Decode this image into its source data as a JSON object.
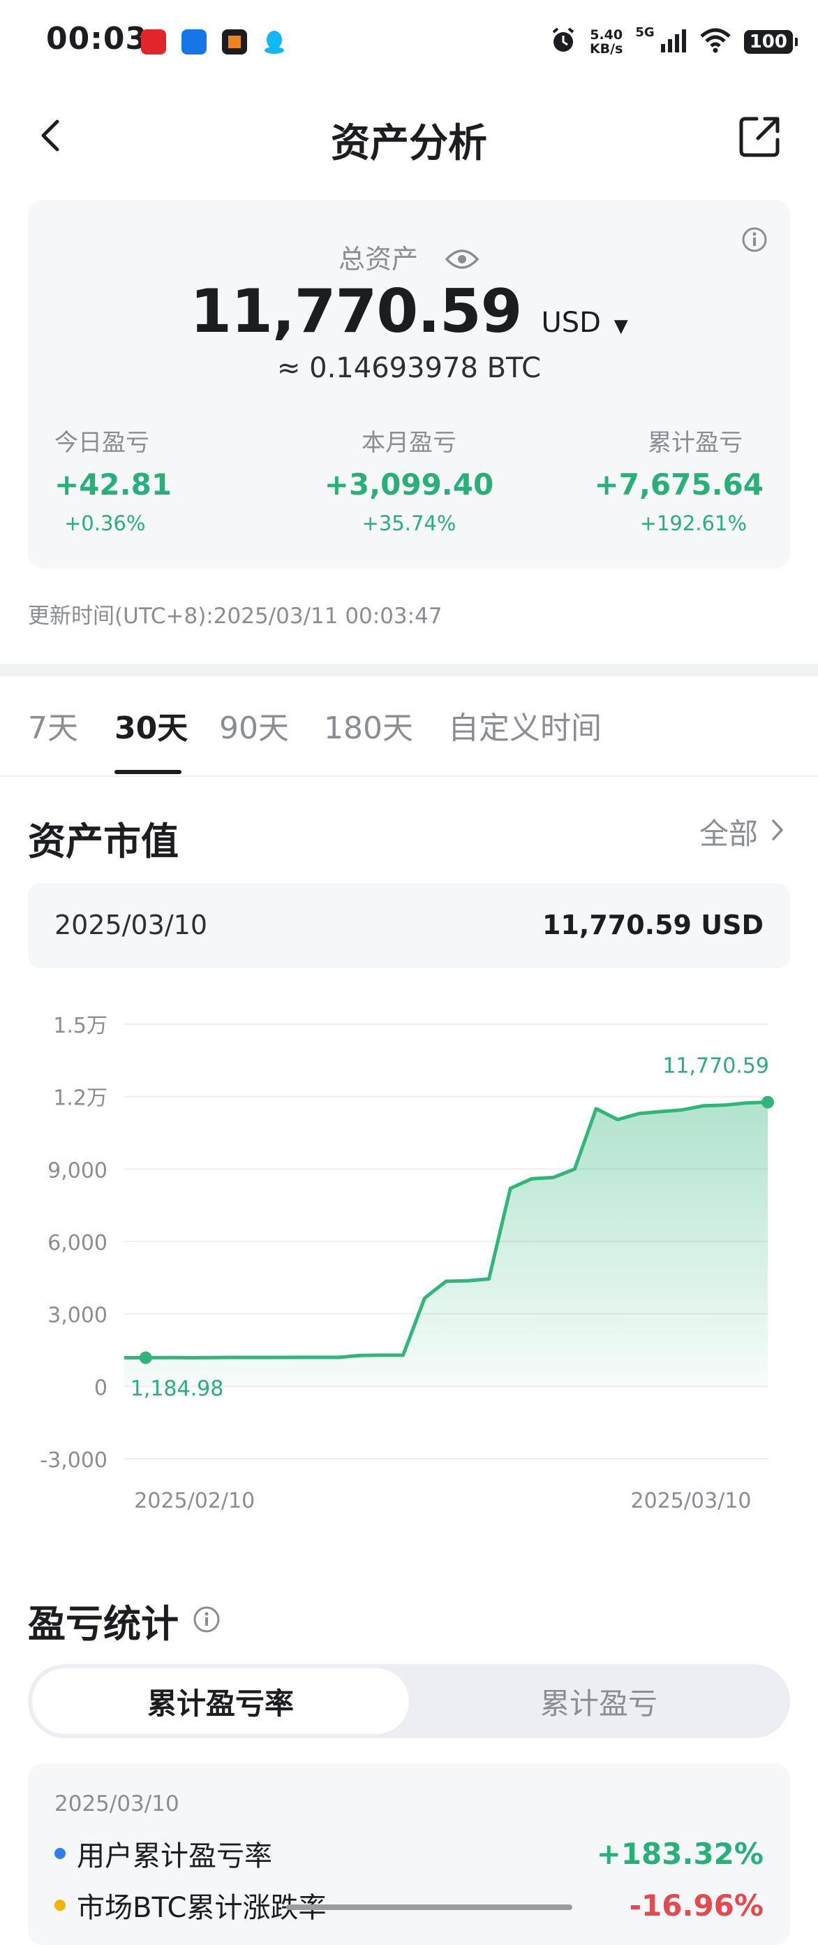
{
  "status_bar": {
    "time": "00:03",
    "net_speed_value": "5.40",
    "net_speed_unit": "KB/s",
    "network": "5G",
    "battery": "100"
  },
  "nav": {
    "title": "资产分析"
  },
  "summary": {
    "total_label": "总资产",
    "total_value": "11,770.59",
    "currency": "USD",
    "btc_equivalent": "≈ 0.14693978 BTC",
    "today": {
      "label": "今日盈亏",
      "value": "+42.81",
      "pct": "+0.36%"
    },
    "month": {
      "label": "本月盈亏",
      "value": "+3,099.40",
      "pct": "+35.74%"
    },
    "cumulative": {
      "label": "累计盈亏",
      "value": "+7,675.64",
      "pct": "+192.61%"
    }
  },
  "update_time": "更新时间(UTC+8):2025/03/11 00:03:47",
  "tabs": [
    "7天",
    "30天",
    "90天",
    "180天",
    "自定义时间"
  ],
  "active_tab": "30天",
  "asset_value": {
    "title": "资产市值",
    "all_link": "全部",
    "selected_date": "2025/03/10",
    "selected_value": "11,770.59 USD"
  },
  "chart_data": {
    "type": "area",
    "ylim": [
      -3000,
      15000
    ],
    "y_ticks": [
      "1.5万",
      "1.2万",
      "9,000",
      "6,000",
      "3,000",
      "0",
      "-3,000"
    ],
    "x_tick_labels": [
      "2025/02/10",
      "2025/03/10"
    ],
    "x_start": "2025/02/09",
    "series": [
      {
        "values": [
          1185,
          1184.98,
          1190,
          1185,
          1190,
          1195,
          1195,
          1195,
          1200,
          1200,
          1200,
          1280,
          1290,
          1290,
          3650,
          4350,
          4370,
          4450,
          8200,
          8600,
          8650,
          9000,
          11500,
          11050,
          11300,
          11380,
          11450,
          11620,
          11650,
          11740,
          11770.59
        ]
      }
    ],
    "annotations": {
      "max_label": "11,770.59",
      "min_label": "1,184.98"
    },
    "line_color": "#31b57a",
    "fill_color": "#31b57a",
    "grid": true
  },
  "pnl": {
    "title": "盈亏统计",
    "seg_active": "累计盈亏率",
    "seg_inactive": "累计盈亏",
    "date": "2025/03/10",
    "rows": [
      {
        "label": "用户累计盈亏率",
        "value": "+183.32%",
        "dot_color": "#2f80ed",
        "value_color": "#28b07a"
      },
      {
        "label": "市场BTC累计涨跌率",
        "value": "-16.96%",
        "dot_color": "#f5b400",
        "value_color": "#e5484d"
      }
    ]
  },
  "colors": {
    "positive": "#28b07a",
    "negative": "#e5484d",
    "card_bg": "#f6f7f9"
  }
}
